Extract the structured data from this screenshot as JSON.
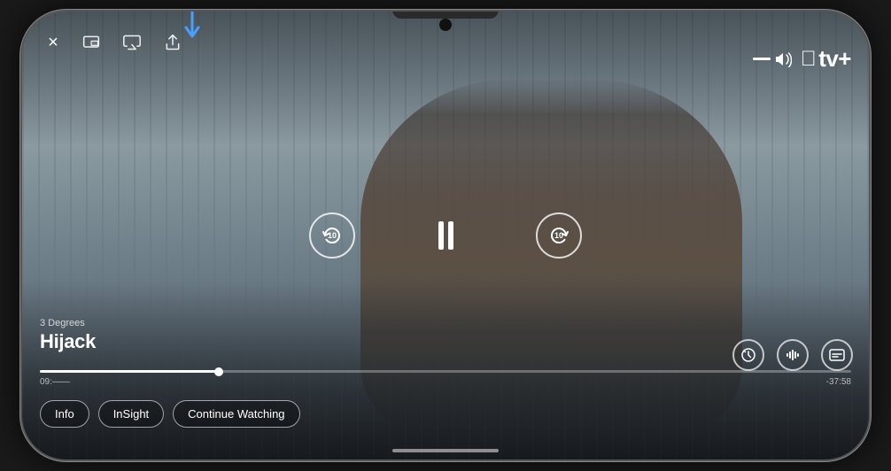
{
  "app": {
    "name": "Apple TV+",
    "brand": "tv+"
  },
  "video": {
    "show": "Hijack",
    "episode": "3 Degrees",
    "current_time": "09:——",
    "remaining_time": "-37:58",
    "progress_percent": 22
  },
  "top_controls": {
    "close_label": "×",
    "pip_label": "picture-in-picture",
    "airplay_label": "AirPlay",
    "share_label": "Share"
  },
  "center_controls": {
    "rewind_seconds": "10",
    "forward_seconds": "10",
    "pause_label": "Pause"
  },
  "right_controls": {
    "speed_label": "speed",
    "audio_label": "audio",
    "subtitles_label": "subtitles"
  },
  "bottom_buttons": [
    {
      "label": "Info",
      "id": "info"
    },
    {
      "label": "InSight",
      "id": "insight"
    },
    {
      "label": "Continue Watching",
      "id": "continue-watching"
    }
  ],
  "blue_arrow": {
    "pointing_to": "AirPlay button"
  },
  "colors": {
    "accent_blue": "#4A9EFF",
    "white": "#FFFFFF",
    "progress_fill": "#FFFFFF"
  }
}
